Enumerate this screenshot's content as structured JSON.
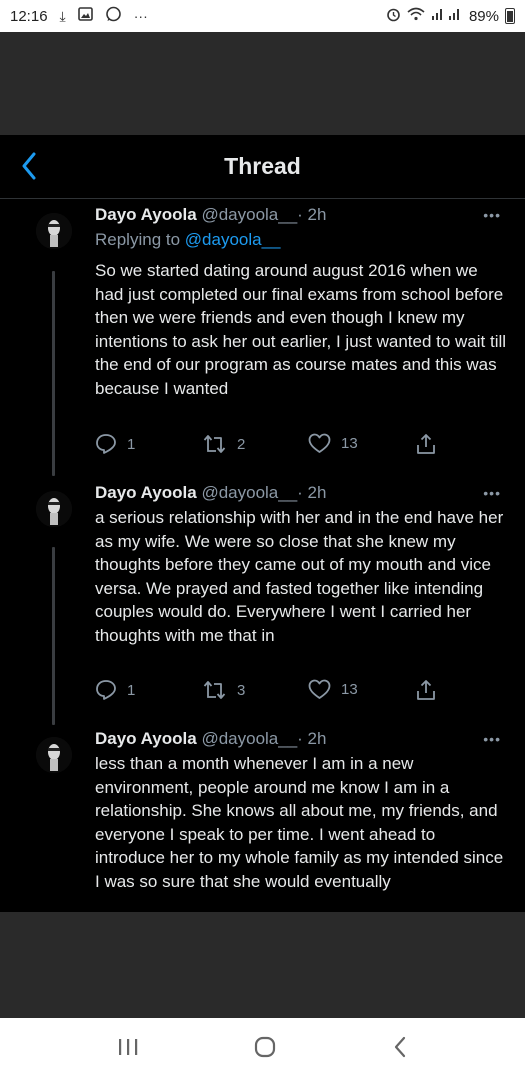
{
  "status_bar": {
    "time": "12:16",
    "battery": "89%",
    "icons": [
      "download-icon",
      "image-icon",
      "whatsapp-icon",
      "more-dots-icon",
      "alarm-icon",
      "wifi-icon",
      "signal-icon",
      "battery-icon"
    ]
  },
  "header": {
    "title": "Thread"
  },
  "tweets": [
    {
      "name": "Dayo Ayoola",
      "handle": "@dayoola__",
      "time": "· 2h",
      "replying_label": "Replying to",
      "replying_handle": "@dayoola__",
      "text": "So we started dating around august 2016 when we had just completed our final exams from school before then we were friends and even though I knew my intentions to ask her out earlier, I just wanted to wait till the end of our program as course mates and this was because I wanted",
      "replies": "1",
      "retweets": "2",
      "likes": "13"
    },
    {
      "name": "Dayo Ayoola",
      "handle": "@dayoola__",
      "time": "· 2h",
      "text": "a serious relationship with her and in the end have her as my wife. We were so close that she knew my thoughts before they came out of my mouth and vice versa. We prayed and fasted together like intending couples would do. Everywhere I went I carried her thoughts with me that in",
      "replies": "1",
      "retweets": "3",
      "likes": "13"
    },
    {
      "name": "Dayo Ayoola",
      "handle": "@dayoola__",
      "time": "· 2h",
      "text": "less than a month whenever I am in a new environment, people around me know I am in a relationship. She knows all about me, my friends, and everyone I speak to per time. I went ahead to introduce her to my whole family as my intended since I was so sure that she would eventually"
    }
  ],
  "colors": {
    "accent": "#1d9bf0",
    "background": "#000000",
    "secondary_text": "#8b98a5"
  }
}
